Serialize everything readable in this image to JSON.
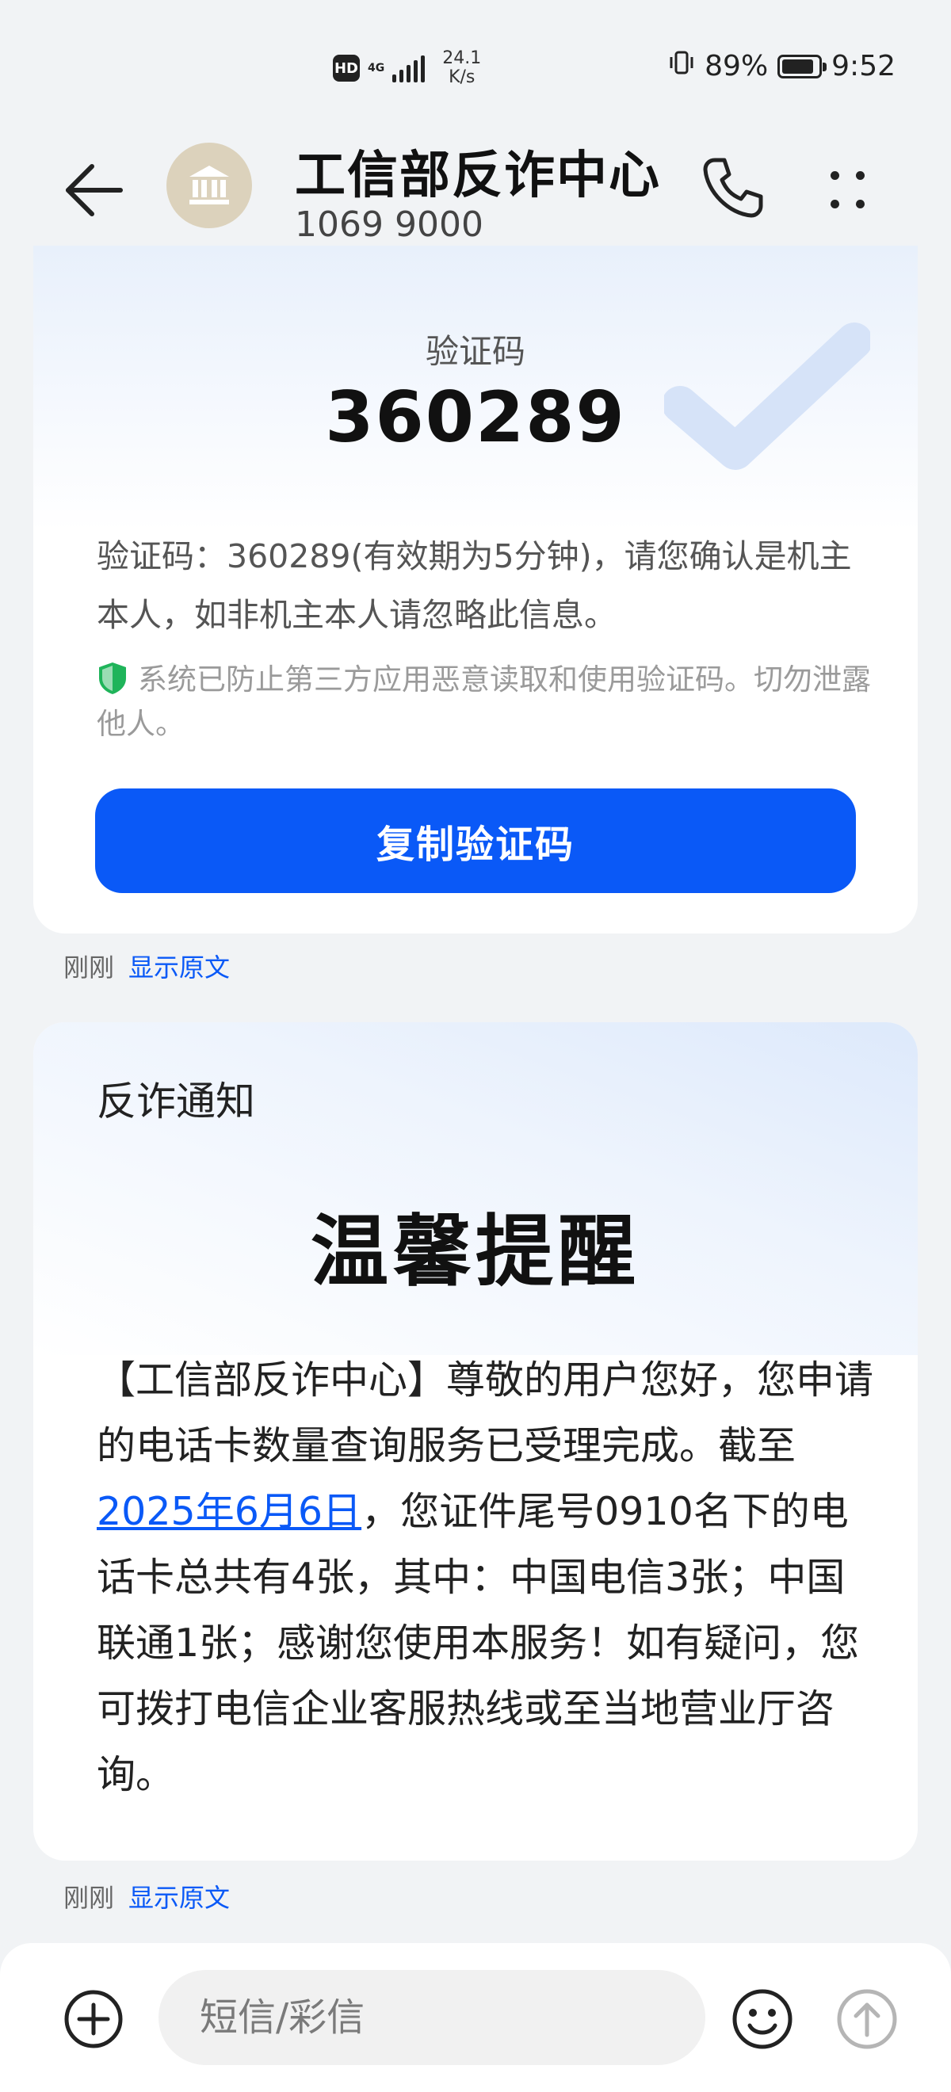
{
  "status_bar": {
    "hd": "HD",
    "network": "4G",
    "speed_value": "24.1",
    "speed_unit": "K/s",
    "battery_percent": "89%",
    "time": "9:52",
    "battery_level": 0.89
  },
  "header": {
    "title": "工信部反诈中心",
    "number": "1069 9000",
    "icons": [
      "back-arrow-icon",
      "bank-icon",
      "phone-icon",
      "more-icon"
    ]
  },
  "otp_card": {
    "label": "验证码",
    "code": "360289",
    "body": "验证码：360289(有效期为5分钟)，请您确认是机主本人，如非机主本人请忽略此信息。",
    "security_note": "系统已防止第三方应用恶意读取和使用验证码。切勿泄露他人。",
    "copy_button": "复制验证码",
    "time": "刚刚",
    "show_original": "显示原文"
  },
  "notice_card": {
    "label": "反诈通知",
    "title": "温馨提醒",
    "body_prefix": "【工信部反诈中心】尊敬的用户您好，您申请的电话卡数量查询服务已受理完成。截至",
    "date_link": "2025年6月6日",
    "body_suffix": "，您证件尾号0910名下的电话卡总共有4张，其中：中国电信3张；中国联通1张；感谢您使用本服务！如有疑问，您可拨打电信企业客服热线或至当地营业厅咨询。",
    "time": "刚刚",
    "show_original": "显示原文"
  },
  "input_bar": {
    "placeholder": "短信/彩信",
    "icons": [
      "plus-icon",
      "emoji-icon",
      "send-icon"
    ]
  },
  "colors": {
    "accent": "#0a59f7",
    "avatar_bg": "#dcd2bc",
    "shield": "#1fb45a"
  }
}
